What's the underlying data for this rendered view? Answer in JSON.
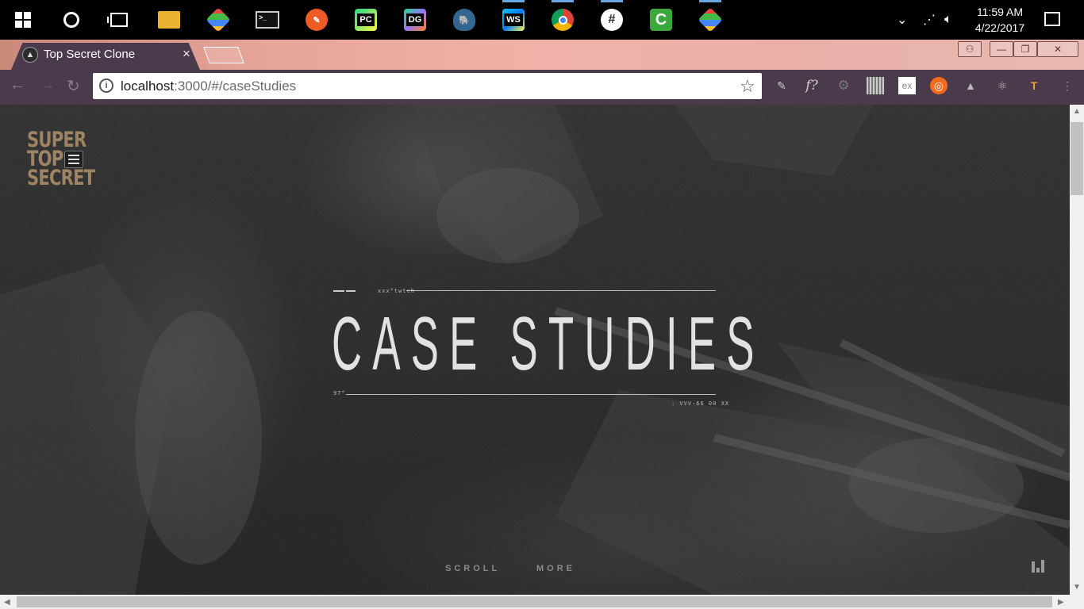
{
  "taskbar": {
    "apps": [
      {
        "name": "file-explorer",
        "label": ""
      },
      {
        "name": "sourcetree",
        "label": ""
      },
      {
        "name": "terminal",
        "label": ""
      },
      {
        "name": "postman",
        "label": ""
      },
      {
        "name": "pycharm",
        "label": "PC"
      },
      {
        "name": "datagrip",
        "label": "DG"
      },
      {
        "name": "postgresql",
        "label": ""
      },
      {
        "name": "webstorm",
        "label": "WS"
      },
      {
        "name": "chrome",
        "label": ""
      },
      {
        "name": "slack",
        "label": "#"
      },
      {
        "name": "camtasia",
        "label": ""
      },
      {
        "name": "sourcetree-2",
        "label": ""
      }
    ],
    "time": "11:59 AM",
    "date": "4/22/2017"
  },
  "browser": {
    "tab_title": "Top Secret Clone",
    "url_host": "localhost",
    "url_path": ":3000/#/caseStudies"
  },
  "page": {
    "logo": [
      "SUPER",
      "TOP",
      "SECRET"
    ],
    "hero_title": "CASE STUDIES",
    "deco_top": "xxx°twtch",
    "deco_left": "97°",
    "deco_right": ": VVV-66 00   XX",
    "scroll_label": "SCROLL",
    "more_label": "MORE"
  },
  "colors": {
    "logo": "#9c8464",
    "tab_bg": "#4b3a4c",
    "title": "#e2e2e2"
  }
}
